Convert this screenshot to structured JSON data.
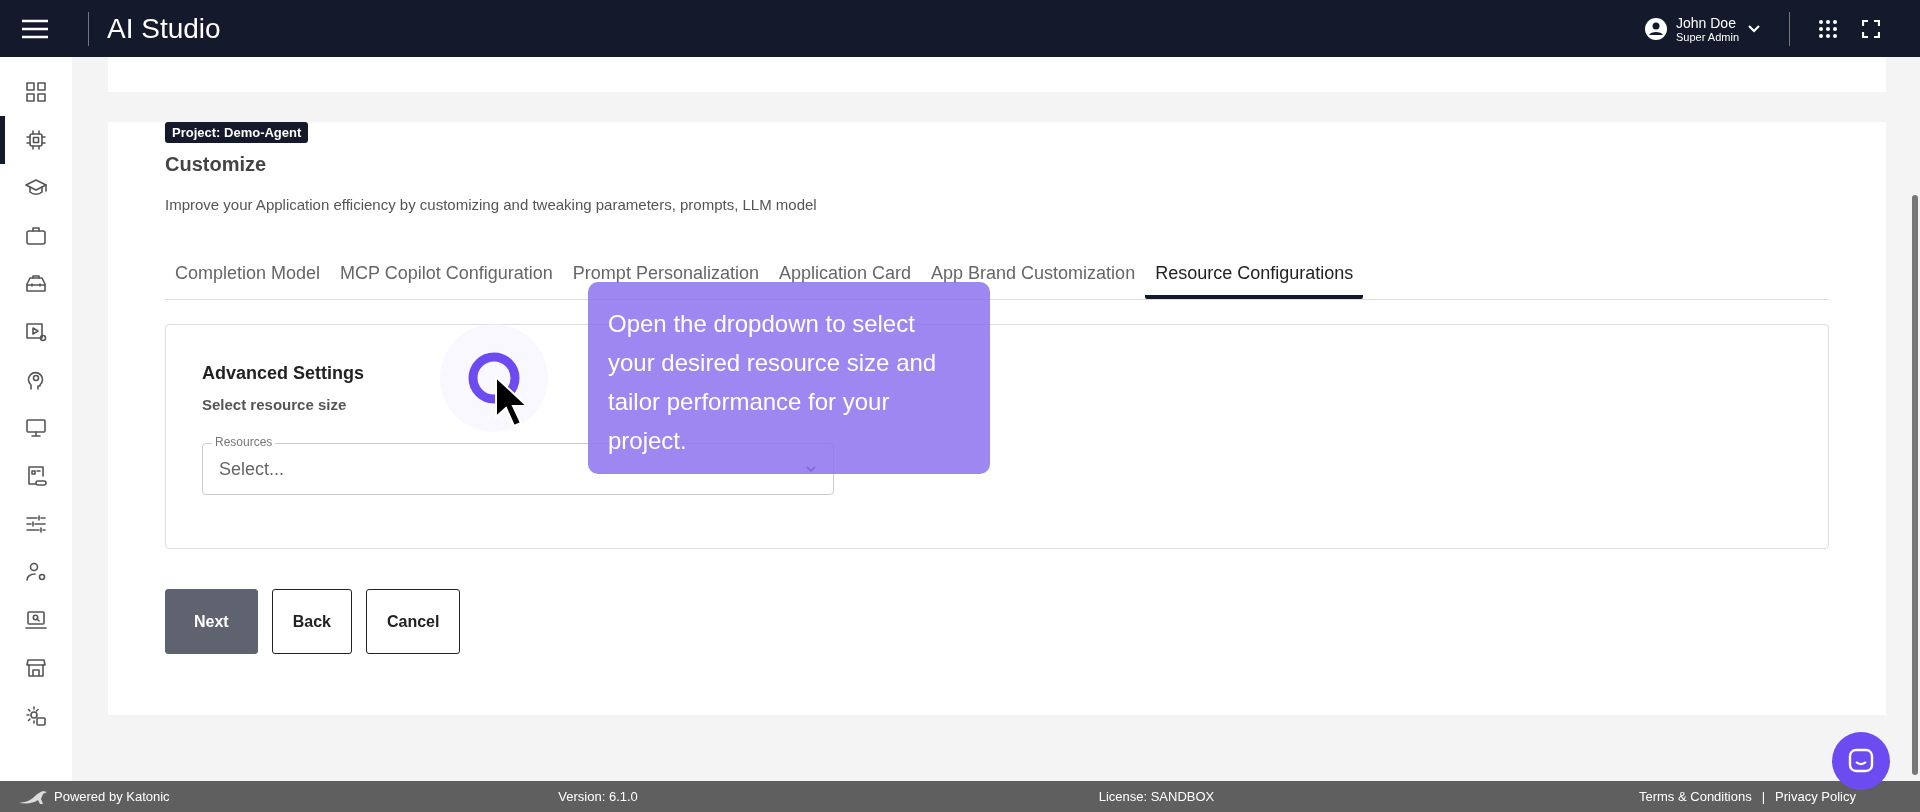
{
  "header": {
    "title": "AI Studio",
    "user_name": "John Doe",
    "user_role": "Super Admin"
  },
  "sidebar": {
    "items": [
      {
        "selected": false
      },
      {
        "selected": true
      },
      {
        "selected": false
      },
      {
        "selected": false
      },
      {
        "selected": false
      },
      {
        "selected": false
      },
      {
        "selected": false
      },
      {
        "selected": false
      },
      {
        "selected": false
      },
      {
        "selected": false
      },
      {
        "selected": false
      },
      {
        "selected": false
      },
      {
        "selected": false
      },
      {
        "selected": false
      }
    ]
  },
  "project_badge": "Project: Demo-Agent",
  "page_title": "Customize",
  "description": "Improve your Application efficiency by customizing and tweaking parameters, prompts, LLM model",
  "tabs": [
    {
      "label": "Completion Model",
      "selected": false
    },
    {
      "label": "MCP Copilot Configuration",
      "selected": false
    },
    {
      "label": "Prompt Personalization",
      "selected": false
    },
    {
      "label": "Application Card",
      "selected": false
    },
    {
      "label": "App Brand Customization",
      "selected": false
    },
    {
      "label": "Resource Configurations",
      "selected": true
    }
  ],
  "panel": {
    "title": "Advanced Settings",
    "subtitle": "Select resource size",
    "field": {
      "label": "Resources",
      "placeholder": "Select..."
    }
  },
  "buttons": [
    {
      "label": "Next",
      "kind": "primary"
    },
    {
      "label": "Back",
      "kind": "outline"
    },
    {
      "label": "Cancel",
      "kind": "outline"
    }
  ],
  "tooltip": "Open the dropdown to select your desired resource size and tailor performance for your project.",
  "footer": {
    "powered": "Powered by Katonic",
    "version": "Version: 6.1.0",
    "license": "License: SANDBOX",
    "terms": "Terms & Conditions",
    "separator": "|",
    "privacy": "Privacy Policy"
  }
}
